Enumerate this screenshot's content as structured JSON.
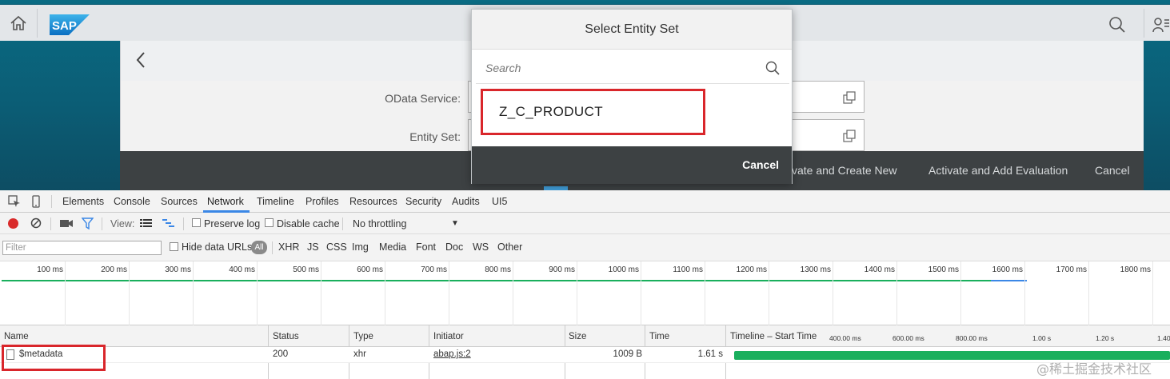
{
  "shell": {
    "logo_text": "SAP",
    "icons": [
      "home-icon",
      "search-icon",
      "user-icon"
    ]
  },
  "form": {
    "odata_label": "OData Service:",
    "entity_label": "Entity Set:",
    "odata_value": "",
    "entity_value": ""
  },
  "footer": {
    "btn_activate_new": "tivate and Create New",
    "btn_activate_eval": "Activate and Add Evaluation",
    "btn_cancel": "Cancel"
  },
  "dialog": {
    "title": "Select Entity Set",
    "search_placeholder": "Search",
    "items": [
      "Z_C_PRODUCT"
    ],
    "cancel_label": "Cancel"
  },
  "devtools": {
    "tabs": [
      "Elements",
      "Console",
      "Sources",
      "Network",
      "Timeline",
      "Profiles",
      "Resources",
      "Security",
      "Audits",
      "UI5"
    ],
    "active_tab": "Network",
    "toolbar": {
      "view_label": "View:",
      "preserve_log": "Preserve log",
      "disable_cache": "Disable cache",
      "throttling": "No throttling"
    },
    "filter": {
      "placeholder": "Filter",
      "hide_data_urls": "Hide data URLs",
      "types": [
        "All",
        "XHR",
        "JS",
        "CSS",
        "Img",
        "Media",
        "Font",
        "Doc",
        "WS",
        "Other"
      ]
    },
    "overview_ticks": [
      "100 ms",
      "200 ms",
      "300 ms",
      "400 ms",
      "500 ms",
      "600 ms",
      "700 ms",
      "800 ms",
      "900 ms",
      "1000 ms",
      "1100 ms",
      "1200 ms",
      "1300 ms",
      "1400 ms",
      "1500 ms",
      "1600 ms",
      "1700 ms",
      "1800 ms"
    ],
    "columns": [
      "Name",
      "Status",
      "Type",
      "Initiator",
      "Size",
      "Time",
      "Timeline – Start Time"
    ],
    "timeline_ticks": [
      "400.00 ms",
      "600.00 ms",
      "800.00 ms",
      "1.00 s",
      "1.20 s",
      "1.40"
    ],
    "rows": [
      {
        "name": "$metadata",
        "status": "200",
        "type": "xhr",
        "initiator": "abap.js:2",
        "size": "1009 B",
        "time": "1.61 s"
      }
    ]
  },
  "watermark": "@稀土掘金技术社区",
  "colors": {
    "highlight": "#d9262b",
    "shell_bg": "#e3e6e9",
    "footer_bg": "#3d4143",
    "record_red": "#d92b2b",
    "timeline_green": "#1aaf5d"
  }
}
